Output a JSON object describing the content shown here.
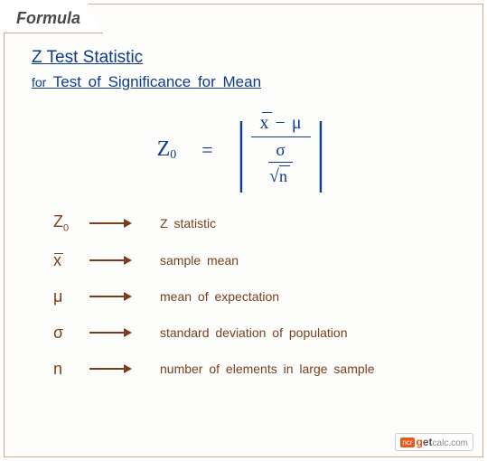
{
  "tab_label": "Formula",
  "title_line1": "Z Test Statistic",
  "title_line2_prefix": "for",
  "title_line2": "Test of Significance for Mean",
  "formula": {
    "lhs": "Z",
    "lhs_sub": "0",
    "eq": "=",
    "numerator": "x̅ − μ",
    "num_xbar": "x",
    "num_minus": "−",
    "num_mu": "μ",
    "den_top": "σ",
    "den_bot_n": "n"
  },
  "legend": [
    {
      "symbol": "Z",
      "sub": "0",
      "desc": "Z statistic"
    },
    {
      "symbol": "x",
      "overline": true,
      "desc": "sample mean"
    },
    {
      "symbol": "μ",
      "desc": "mean of expectation"
    },
    {
      "symbol": "σ",
      "desc": "standard deviation of population"
    },
    {
      "symbol": "n",
      "desc": "number of elements in large sample"
    }
  ],
  "brand": {
    "g": "g",
    "et": "et",
    "calc": "calc.com"
  }
}
